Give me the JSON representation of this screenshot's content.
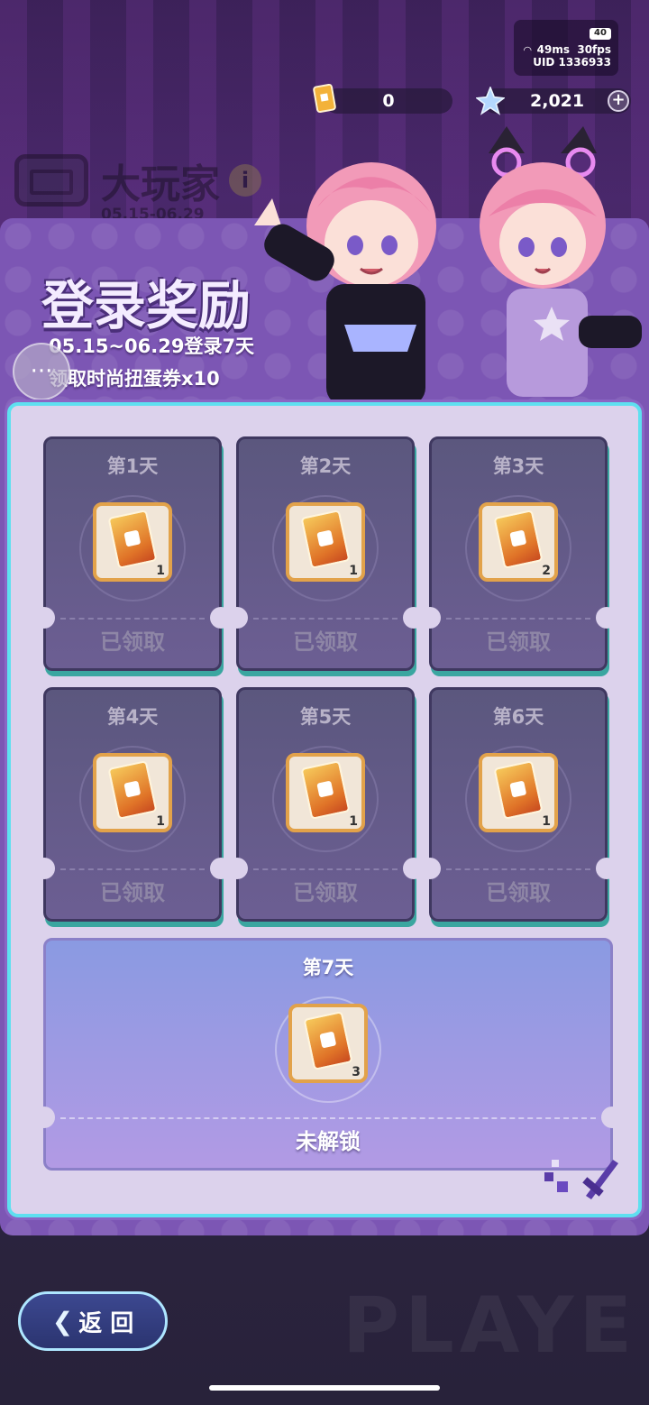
{
  "status": {
    "battery": "40",
    "ping": "49ms",
    "fps": "30fps",
    "uid": "UID 1336933"
  },
  "currency": {
    "tickets": "0",
    "gems": "2,021"
  },
  "game": {
    "title": "大玩家",
    "date": "05.15-06.29"
  },
  "modal": {
    "title": "登录奖励",
    "subtitle_line1": "05.15~06.29登录7天",
    "subtitle_line2": "领取时尚扭蛋券x10"
  },
  "days": [
    {
      "label": "第1天",
      "count": "1",
      "status": "已领取"
    },
    {
      "label": "第2天",
      "count": "1",
      "status": "已领取"
    },
    {
      "label": "第3天",
      "count": "2",
      "status": "已领取"
    },
    {
      "label": "第4天",
      "count": "1",
      "status": "已领取"
    },
    {
      "label": "第5天",
      "count": "1",
      "status": "已领取"
    },
    {
      "label": "第6天",
      "count": "1",
      "status": "已领取"
    },
    {
      "label": "第7天",
      "count": "3",
      "status": "未解锁"
    }
  ],
  "footer": {
    "back_label": "返 回",
    "deco_text": "PLAYE"
  }
}
